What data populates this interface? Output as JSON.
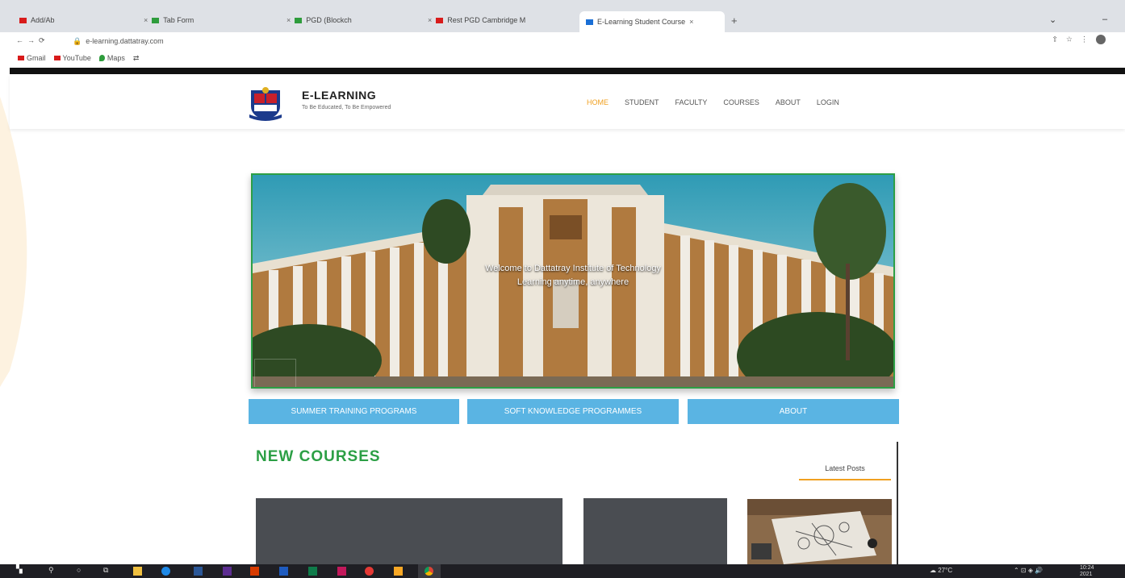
{
  "browser": {
    "tabs": [
      {
        "label": "Add/Ab",
        "color": "#d81b1b"
      },
      {
        "label": "Tab Form",
        "color": "#2e9c3c"
      },
      {
        "label": "PGD (Blockch",
        "color": "#2e9c3c"
      },
      {
        "label": "Rest PGD Cambridge M",
        "color": "#d81b1b"
      },
      {
        "label": "E-Learning Student Course",
        "color": "#1a6fd6"
      }
    ],
    "url": "e-learning.dattatray.com",
    "bookmarks": [
      {
        "label": "Gmail",
        "color": "#d81b1b"
      },
      {
        "label": "YouTube",
        "color": "#d81b1b"
      },
      {
        "label": "Maps",
        "color": "#2e9c3c"
      }
    ]
  },
  "site": {
    "brand": "E-LEARNING",
    "tagline": "To Be Educated, To Be Empowered",
    "nav": [
      {
        "label": "HOME",
        "active": true
      },
      {
        "label": "STUDENT"
      },
      {
        "label": "FACULTY"
      },
      {
        "label": "COURSES"
      },
      {
        "label": "ABOUT"
      },
      {
        "label": "LOGIN"
      }
    ]
  },
  "hero": {
    "caption_line1": "Welcome to Dattatray Institute of Technology",
    "caption_line2": "Learning anytime, anywhere"
  },
  "quick_links": [
    {
      "label": "SUMMER TRAINING PROGRAMS"
    },
    {
      "label": "SOFT KNOWLEDGE PROGRAMMES"
    },
    {
      "label": "ABOUT"
    }
  ],
  "courses": {
    "title": "NEW COURSES",
    "sidebar_tab": "Latest Posts"
  },
  "taskbar": {
    "weather": "27°C",
    "time": "10:24",
    "date": "2021"
  },
  "colors": {
    "accent_green": "#2c9f45",
    "nav_active": "#f0a020",
    "button_blue": "#5ab4e3"
  }
}
